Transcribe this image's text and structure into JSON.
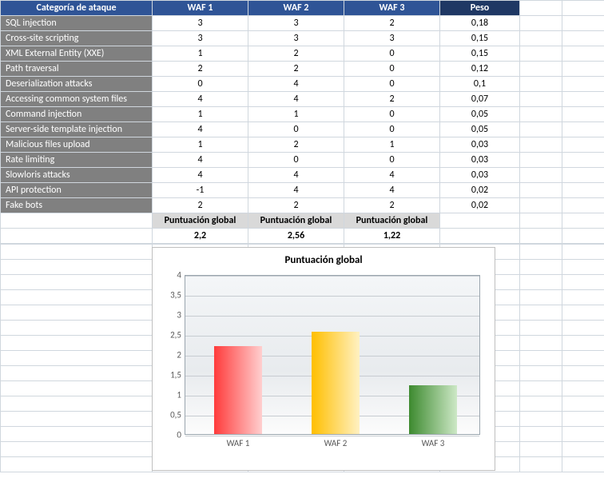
{
  "headers": {
    "category": "Categoría de ataque",
    "waf1": "WAF 1",
    "waf2": "WAF 2",
    "waf3": "WAF 3",
    "peso": "Peso"
  },
  "rows": [
    {
      "cat": "SQL injection",
      "w1": "3",
      "w2": "3",
      "w3": "2",
      "peso": "0,18"
    },
    {
      "cat": "Cross-site scripting",
      "w1": "3",
      "w2": "3",
      "w3": "3",
      "peso": "0,15"
    },
    {
      "cat": "XML External Entity (XXE)",
      "w1": "1",
      "w2": "2",
      "w3": "0",
      "peso": "0,15"
    },
    {
      "cat": "Path traversal",
      "w1": "2",
      "w2": "2",
      "w3": "0",
      "peso": "0,12"
    },
    {
      "cat": "Deserialization attacks",
      "w1": "0",
      "w2": "4",
      "w3": "0",
      "peso": "0,1"
    },
    {
      "cat": "Accessing common system files",
      "w1": "4",
      "w2": "4",
      "w3": "2",
      "peso": "0,07"
    },
    {
      "cat": "Command injection",
      "w1": "1",
      "w2": "1",
      "w3": "0",
      "peso": "0,05"
    },
    {
      "cat": "Server-side template injection",
      "w1": "4",
      "w2": "0",
      "w3": "0",
      "peso": "0,05"
    },
    {
      "cat": "Malicious files upload",
      "w1": "1",
      "w2": "2",
      "w3": "1",
      "peso": "0,03"
    },
    {
      "cat": "Rate limiting",
      "w1": "4",
      "w2": "0",
      "w3": "0",
      "peso": "0,03"
    },
    {
      "cat": "Slowloris attacks",
      "w1": "4",
      "w2": "4",
      "w3": "4",
      "peso": "0,03"
    },
    {
      "cat": "API protection",
      "w1": "-1",
      "w2": "4",
      "w3": "4",
      "peso": "0,02"
    },
    {
      "cat": "Fake bots",
      "w1": "2",
      "w2": "2",
      "w3": "2",
      "peso": "0,02"
    }
  ],
  "summary": {
    "label": "Puntuación global",
    "w1": "2,2",
    "w2": "2,56",
    "w3": "1,22"
  },
  "chart_data": {
    "type": "bar",
    "title": "Puntuación global",
    "categories": [
      "WAF 1",
      "WAF 2",
      "WAF 3"
    ],
    "values": [
      2.2,
      2.56,
      1.22
    ],
    "ylim": [
      0,
      4
    ],
    "ytick": 0.5,
    "ylabels": [
      "0",
      "0,5",
      "1",
      "1,5",
      "2",
      "2,5",
      "3",
      "3,5",
      "4"
    ],
    "colors": [
      "#ff3b3b",
      "#ffbf00",
      "#3d8a2f"
    ]
  }
}
